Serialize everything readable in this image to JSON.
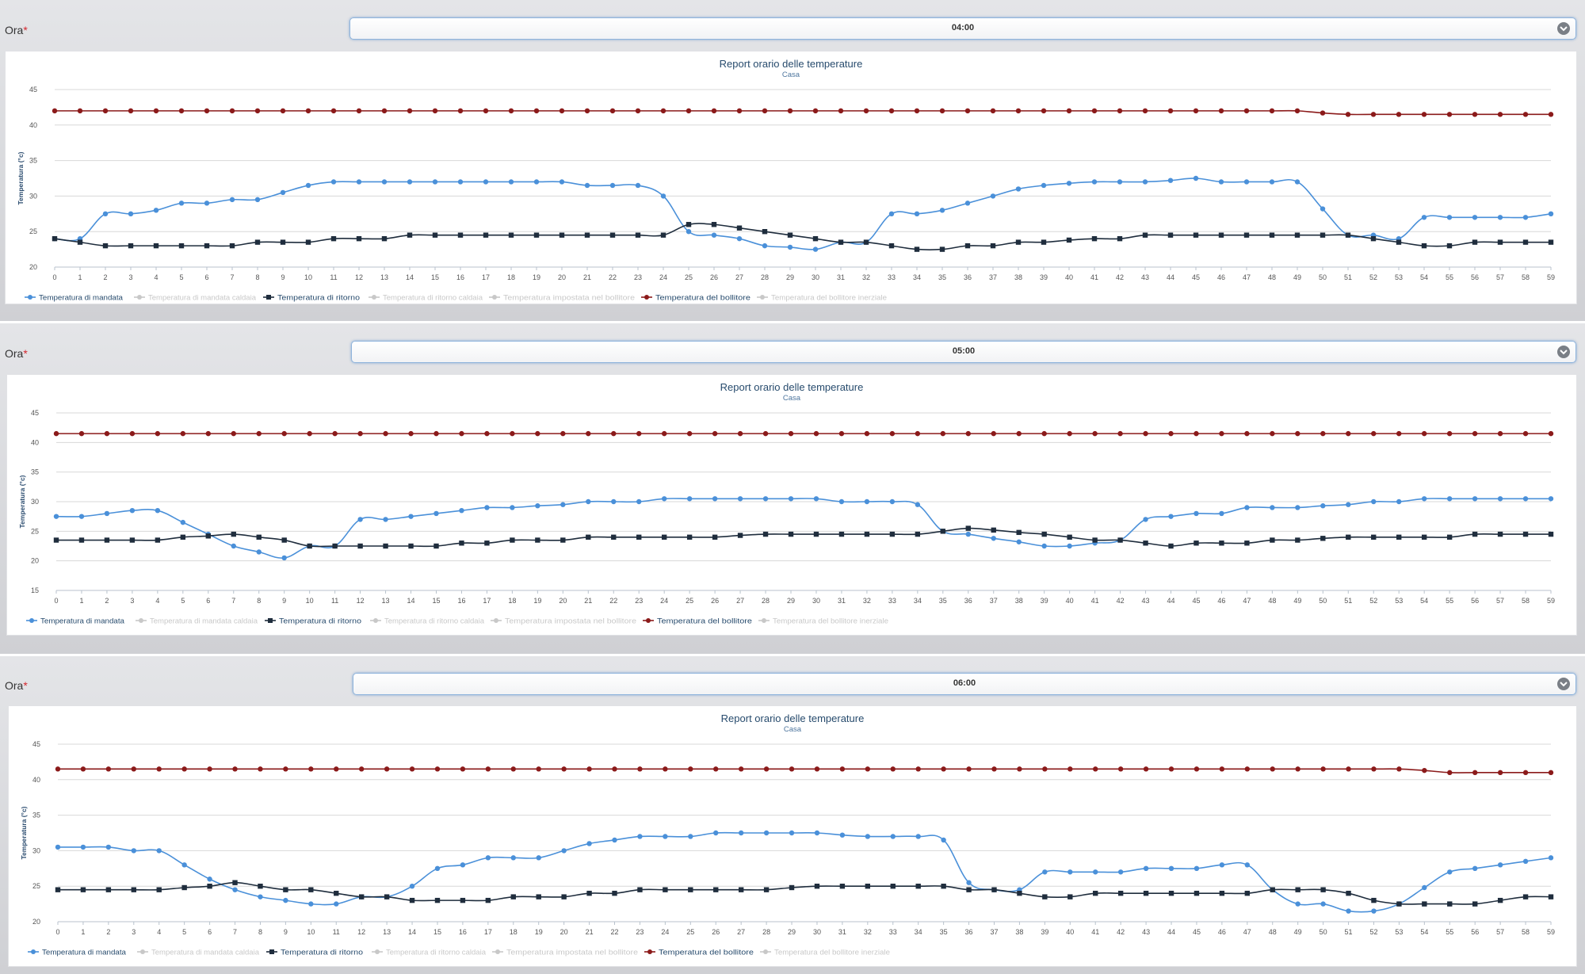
{
  "form": {
    "ora_label": "Ora",
    "required_mark": "*"
  },
  "colors": {
    "mandata": "#4a90d9",
    "ritorno": "#1f2d3d",
    "bollitore": "#8b1a1a",
    "hidden_series": "#c8c8c8",
    "grid": "#d8d8d8"
  },
  "sections": [
    {
      "hour": "04:00"
    },
    {
      "hour": "05:00"
    },
    {
      "hour": "06:00"
    }
  ],
  "chart_data": [
    {
      "type": "line",
      "title": "Report orario delle temperature",
      "subtitle": "Casa",
      "ylabel": "Temperatura (°c)",
      "xlabel": "",
      "ylim": [
        20,
        45
      ],
      "yticks": [
        20,
        25,
        30,
        35,
        40,
        45
      ],
      "x": [
        0,
        1,
        2,
        3,
        4,
        5,
        6,
        7,
        8,
        9,
        10,
        11,
        12,
        13,
        14,
        15,
        16,
        17,
        18,
        19,
        20,
        21,
        22,
        23,
        24,
        25,
        26,
        27,
        28,
        29,
        30,
        31,
        32,
        33,
        34,
        35,
        36,
        37,
        38,
        39,
        40,
        41,
        42,
        43,
        44,
        45,
        46,
        47,
        48,
        49,
        50,
        51,
        52,
        53,
        54,
        55,
        56,
        57,
        58,
        59
      ],
      "grid": true,
      "legend_position": "bottom-left",
      "legend": [
        "Temperatura di mandata",
        "Temperatura di mandata caldaia",
        "Temperatura di ritorno",
        "Temperatura di ritorno caldaia",
        "Temperatura impostata nel bollitore",
        "Temperatura del bollitore",
        "Temperatura del bollitore inerziale"
      ],
      "series": [
        {
          "name": "Temperatura di mandata",
          "values": [
            24,
            24,
            27.5,
            27.5,
            28,
            29,
            29,
            29.5,
            29.5,
            30.5,
            31.5,
            32,
            32,
            32,
            32,
            32,
            32,
            32,
            32,
            32,
            32,
            31.5,
            31.5,
            31.5,
            30,
            25,
            24.5,
            24,
            23,
            22.8,
            22.5,
            23.5,
            23.5,
            27.5,
            27.5,
            28,
            29,
            30,
            31,
            31.5,
            31.8,
            32,
            32,
            32,
            32.2,
            32.5,
            32,
            32,
            32,
            32,
            28.2,
            24.5,
            24.5,
            24,
            27,
            27,
            27,
            27,
            27,
            27.5
          ]
        },
        {
          "name": "Temperatura di ritorno",
          "values": [
            24,
            23.5,
            23,
            23,
            23,
            23,
            23,
            23,
            23.5,
            23.5,
            23.5,
            24,
            24,
            24,
            24.5,
            24.5,
            24.5,
            24.5,
            24.5,
            24.5,
            24.5,
            24.5,
            24.5,
            24.5,
            24.5,
            26,
            26,
            25.5,
            25,
            24.5,
            24,
            23.5,
            23.5,
            23,
            22.5,
            22.5,
            23,
            23,
            23.5,
            23.5,
            23.8,
            24,
            24,
            24.5,
            24.5,
            24.5,
            24.5,
            24.5,
            24.5,
            24.5,
            24.5,
            24.5,
            24,
            23.5,
            23,
            23,
            23.5,
            23.5,
            23.5,
            23.5
          ]
        },
        {
          "name": "Temperatura del bollitore",
          "values": [
            42,
            42,
            42,
            42,
            42,
            42,
            42,
            42,
            42,
            42,
            42,
            42,
            42,
            42,
            42,
            42,
            42,
            42,
            42,
            42,
            42,
            42,
            42,
            42,
            42,
            42,
            42,
            42,
            42,
            42,
            42,
            42,
            42,
            42,
            42,
            42,
            42,
            42,
            42,
            42,
            42,
            42,
            42,
            42,
            42,
            42,
            42,
            42,
            42,
            42,
            41.7,
            41.5,
            41.5,
            41.5,
            41.5,
            41.5,
            41.5,
            41.5,
            41.5,
            41.5
          ]
        }
      ]
    },
    {
      "type": "line",
      "title": "Report orario delle temperature",
      "subtitle": "Casa",
      "ylabel": "Temperatura (°c)",
      "xlabel": "",
      "ylim": [
        15,
        45
      ],
      "yticks": [
        15,
        20,
        25,
        30,
        35,
        40,
        45
      ],
      "x": [
        0,
        1,
        2,
        3,
        4,
        5,
        6,
        7,
        8,
        9,
        10,
        11,
        12,
        13,
        14,
        15,
        16,
        17,
        18,
        19,
        20,
        21,
        22,
        23,
        24,
        25,
        26,
        27,
        28,
        29,
        30,
        31,
        32,
        33,
        34,
        35,
        36,
        37,
        38,
        39,
        40,
        41,
        42,
        43,
        44,
        45,
        46,
        47,
        48,
        49,
        50,
        51,
        52,
        53,
        54,
        55,
        56,
        57,
        58,
        59
      ],
      "grid": true,
      "legend_position": "bottom-left",
      "legend": [
        "Temperatura di mandata",
        "Temperatura di mandata caldaia",
        "Temperatura di ritorno",
        "Temperatura di ritorno caldaia",
        "Temperatura impostata nel bollitore",
        "Temperatura del bollitore",
        "Temperatura del bollitore inerziale"
      ],
      "series": [
        {
          "name": "Temperatura di mandata",
          "values": [
            27.5,
            27.5,
            28,
            28.5,
            28.5,
            26.5,
            24.5,
            22.5,
            21.5,
            20.5,
            22.5,
            22.5,
            27,
            27,
            27.5,
            28,
            28.5,
            29,
            29,
            29.3,
            29.5,
            30,
            30,
            30,
            30.5,
            30.5,
            30.5,
            30.5,
            30.5,
            30.5,
            30.5,
            30,
            30,
            30,
            29.5,
            25,
            24.5,
            23.8,
            23.2,
            22.5,
            22.5,
            23,
            23.5,
            27,
            27.5,
            28,
            28,
            29,
            29,
            29,
            29.3,
            29.5,
            30,
            30,
            30.5,
            30.5,
            30.5,
            30.5,
            30.5,
            30.5
          ]
        },
        {
          "name": "Temperatura di ritorno",
          "values": [
            23.5,
            23.5,
            23.5,
            23.5,
            23.5,
            24,
            24.2,
            24.5,
            24,
            23.5,
            22.5,
            22.5,
            22.5,
            22.5,
            22.5,
            22.5,
            23,
            23,
            23.5,
            23.5,
            23.5,
            24,
            24,
            24,
            24,
            24,
            24,
            24.3,
            24.5,
            24.5,
            24.5,
            24.5,
            24.5,
            24.5,
            24.5,
            25,
            25.5,
            25.2,
            24.8,
            24.5,
            24,
            23.5,
            23.5,
            23,
            22.5,
            23,
            23,
            23,
            23.5,
            23.5,
            23.8,
            24,
            24,
            24,
            24,
            24,
            24.5,
            24.5,
            24.5,
            24.5
          ]
        },
        {
          "name": "Temperatura del bollitore",
          "values": [
            41.5,
            41.5,
            41.5,
            41.5,
            41.5,
            41.5,
            41.5,
            41.5,
            41.5,
            41.5,
            41.5,
            41.5,
            41.5,
            41.5,
            41.5,
            41.5,
            41.5,
            41.5,
            41.5,
            41.5,
            41.5,
            41.5,
            41.5,
            41.5,
            41.5,
            41.5,
            41.5,
            41.5,
            41.5,
            41.5,
            41.5,
            41.5,
            41.5,
            41.5,
            41.5,
            41.5,
            41.5,
            41.5,
            41.5,
            41.5,
            41.5,
            41.5,
            41.5,
            41.5,
            41.5,
            41.5,
            41.5,
            41.5,
            41.5,
            41.5,
            41.5,
            41.5,
            41.5,
            41.5,
            41.5,
            41.5,
            41.5,
            41.5,
            41.5,
            41.5
          ]
        }
      ]
    },
    {
      "type": "line",
      "title": "Report orario delle temperature",
      "subtitle": "Casa",
      "ylabel": "Temperatura (°c)",
      "xlabel": "",
      "ylim": [
        20,
        45
      ],
      "yticks": [
        20,
        25,
        30,
        35,
        40,
        45
      ],
      "x": [
        0,
        1,
        2,
        3,
        4,
        5,
        6,
        7,
        8,
        9,
        10,
        11,
        12,
        13,
        14,
        15,
        16,
        17,
        18,
        19,
        20,
        21,
        22,
        23,
        24,
        25,
        26,
        27,
        28,
        29,
        30,
        31,
        32,
        33,
        34,
        35,
        36,
        37,
        38,
        39,
        40,
        41,
        42,
        43,
        44,
        45,
        46,
        47,
        48,
        49,
        50,
        51,
        52,
        53,
        54,
        55,
        56,
        57,
        58,
        59
      ],
      "grid": true,
      "legend_position": "bottom-left",
      "legend": [
        "Temperatura di mandata",
        "Temperatura di mandata caldaia",
        "Temperatura di ritorno",
        "Temperatura di ritorno caldaia",
        "Temperatura impostata nel bollitore",
        "Temperatura del bollitore",
        "Temperatura del bollitore inerziale"
      ],
      "series": [
        {
          "name": "Temperatura di mandata",
          "values": [
            30.5,
            30.5,
            30.5,
            30,
            30,
            28,
            26,
            24.5,
            23.5,
            23,
            22.5,
            22.5,
            23.5,
            23.5,
            25,
            27.5,
            28,
            29,
            29,
            29,
            30,
            31,
            31.5,
            32,
            32,
            32,
            32.5,
            32.5,
            32.5,
            32.5,
            32.5,
            32.2,
            32,
            32,
            32,
            31.5,
            25.5,
            24.5,
            24.5,
            27,
            27,
            27,
            27,
            27.5,
            27.5,
            27.5,
            28,
            28,
            24.5,
            22.5,
            22.5,
            21.5,
            21.5,
            22.5,
            24.8,
            27,
            27.5,
            28,
            28.5,
            29
          ]
        },
        {
          "name": "Temperatura di ritorno",
          "values": [
            24.5,
            24.5,
            24.5,
            24.5,
            24.5,
            24.8,
            25,
            25.5,
            25,
            24.5,
            24.5,
            24,
            23.5,
            23.5,
            23,
            23,
            23,
            23,
            23.5,
            23.5,
            23.5,
            24,
            24,
            24.5,
            24.5,
            24.5,
            24.5,
            24.5,
            24.5,
            24.8,
            25,
            25,
            25,
            25,
            25,
            25,
            24.5,
            24.5,
            24,
            23.5,
            23.5,
            24,
            24,
            24,
            24,
            24,
            24,
            24,
            24.5,
            24.5,
            24.5,
            24,
            23,
            22.5,
            22.5,
            22.5,
            22.5,
            23,
            23.5,
            23.5
          ]
        },
        {
          "name": "Temperatura del bollitore",
          "values": [
            41.5,
            41.5,
            41.5,
            41.5,
            41.5,
            41.5,
            41.5,
            41.5,
            41.5,
            41.5,
            41.5,
            41.5,
            41.5,
            41.5,
            41.5,
            41.5,
            41.5,
            41.5,
            41.5,
            41.5,
            41.5,
            41.5,
            41.5,
            41.5,
            41.5,
            41.5,
            41.5,
            41.5,
            41.5,
            41.5,
            41.5,
            41.5,
            41.5,
            41.5,
            41.5,
            41.5,
            41.5,
            41.5,
            41.5,
            41.5,
            41.5,
            41.5,
            41.5,
            41.5,
            41.5,
            41.5,
            41.5,
            41.5,
            41.5,
            41.5,
            41.5,
            41.5,
            41.5,
            41.5,
            41.3,
            41,
            41,
            41,
            41,
            41
          ]
        }
      ]
    }
  ]
}
